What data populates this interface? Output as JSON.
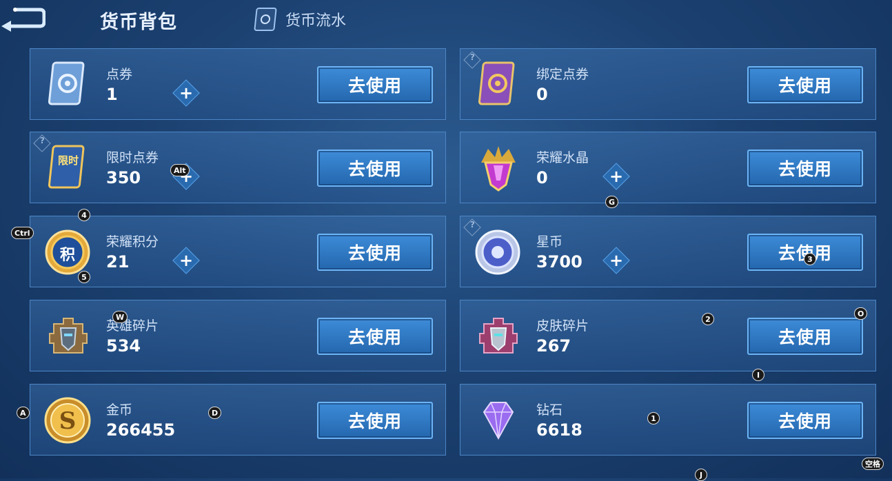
{
  "header": {
    "title": "货币背包",
    "flow_tab": "货币流水"
  },
  "use_label": "去使用",
  "help_mark": "?",
  "plus_mark": "+",
  "cards": [
    {
      "name": "点券",
      "amount": "1"
    },
    {
      "name": "绑定点券",
      "amount": "0"
    },
    {
      "name": "限时点券",
      "amount": "350"
    },
    {
      "name": "荣耀水晶",
      "amount": "0"
    },
    {
      "name": "荣耀积分",
      "amount": "21"
    },
    {
      "name": "星币",
      "amount": "3700"
    },
    {
      "name": "英雄碎片",
      "amount": "534"
    },
    {
      "name": "皮肤碎片",
      "amount": "267"
    },
    {
      "name": "金币",
      "amount": "266455"
    },
    {
      "name": "钻石",
      "amount": "6618"
    }
  ],
  "icon_labels": {
    "limited": "限时",
    "points": "积"
  },
  "key_hints": [
    "Alt",
    "4",
    "Ctrl",
    "5",
    "G",
    "3",
    "W",
    "2",
    "O",
    "I",
    "A",
    "D",
    "1",
    "空格",
    "J"
  ],
  "colors": {
    "background": "#1c4272",
    "card_border": "#4d86c5",
    "button": "#2f79c4"
  }
}
